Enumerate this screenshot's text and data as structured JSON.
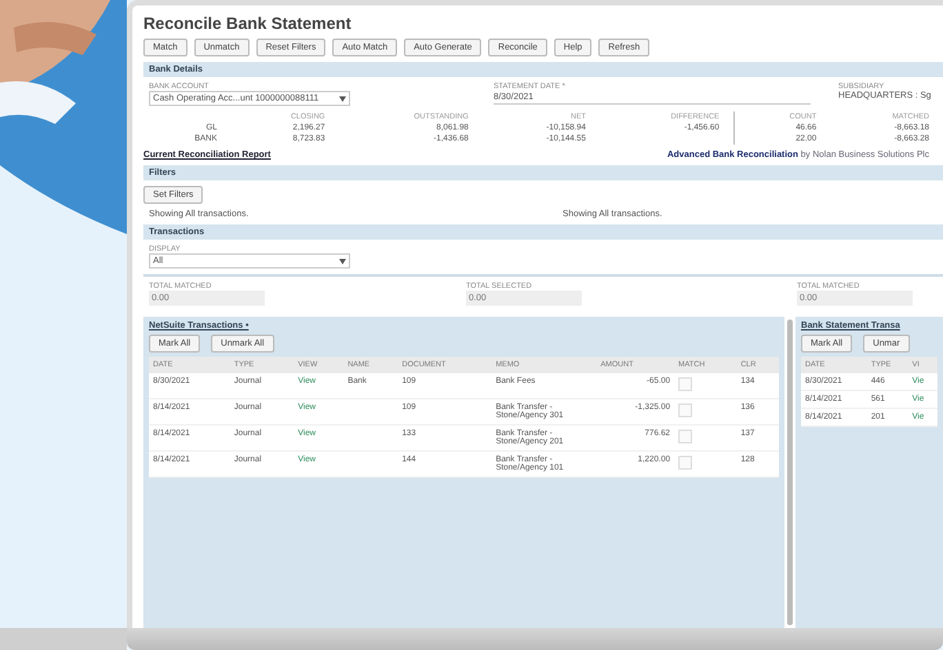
{
  "page": {
    "title": "Reconcile Bank Statement"
  },
  "toolbar": [
    "Match",
    "Unmatch",
    "Reset Filters",
    "Auto Match",
    "Auto Generate",
    "Reconcile",
    "Help",
    "Refresh"
  ],
  "bank_details": {
    "header": "Bank Details",
    "fields": [
      {
        "label": "BANK ACCOUNT",
        "value": "Cash Operating Acc...unt 1000000088111",
        "kind": "select"
      },
      {
        "label": "STATEMENT DATE *",
        "value": "8/30/2021",
        "kind": "input"
      },
      {
        "label": "SUBSIDIARY",
        "value": "HEADQUARTERS : Sg",
        "kind": "text"
      }
    ],
    "summary_columns": [
      "",
      "CLOSING",
      "OUTSTANDING",
      "NET",
      "DIFFERENCE",
      "COUNT",
      "MATCHED"
    ],
    "summary_rows": [
      [
        "GL",
        "2,196.27",
        "8,061.98",
        "-10,158.94",
        "-1,456.60",
        "46.66",
        "-8,663.18"
      ],
      [
        "BANK",
        "8,723.83",
        "-1,436.68",
        "-10,144.55",
        "",
        "22.00",
        "-8,663.28"
      ]
    ]
  },
  "report_link": "Current Reconciliation Report",
  "credit": "**Advanced Bank Reconciliation** by Nolan Business Solutions Plc",
  "filters": {
    "header": "Filters",
    "button": "Set Filters",
    "left_note": "Showing All transactions.",
    "right_note": "Showing All transactions."
  },
  "transactions": {
    "header": "Transactions",
    "display_label": "DISPLAY",
    "display_value": "All",
    "totals": [
      {
        "label": "TOTAL MATCHED",
        "value": "0.00"
      },
      {
        "label": "TOTAL SELECTED",
        "value": "0.00"
      }
    ],
    "right_total": {
      "label": "TOTAL MATCHED",
      "value": "0.00"
    }
  },
  "netsuite": {
    "title": "NetSuite Transactions •",
    "buttons": [
      "Mark All",
      "Unmark All"
    ],
    "columns": [
      "DATE",
      "TYPE",
      "VIEW",
      "NAME",
      "DOCUMENT",
      "MEMO",
      "AMOUNT",
      "MATCH",
      "CLR"
    ],
    "rows": [
      {
        "date": "8/30/2021",
        "type": "Journal",
        "view": "View",
        "name": "Bank",
        "document": "109",
        "memo": "Bank Fees",
        "amount": "-65.00",
        "match": false,
        "clr": "134"
      },
      {
        "date": "8/14/2021",
        "type": "Journal",
        "view": "View",
        "name": "",
        "document": "109",
        "memo": "Bank Transfer - Stone/Agency 301",
        "amount": "-1,325.00",
        "match": false,
        "clr": "136"
      },
      {
        "date": "8/14/2021",
        "type": "Journal",
        "view": "View",
        "name": "",
        "document": "133",
        "memo": "Bank Transfer - Stone/Agency 201",
        "amount": "776.62",
        "match": false,
        "clr": "137"
      },
      {
        "date": "8/14/2021",
        "type": "Journal",
        "view": "View",
        "name": "",
        "document": "144",
        "memo": "Bank Transfer - Stone/Agency 101",
        "amount": "1,220.00",
        "match": false,
        "clr": "128"
      }
    ]
  },
  "bank_statement": {
    "title": "Bank Statement Transa",
    "buttons": [
      "Mark All",
      "Unmar"
    ],
    "columns": [
      "DATE",
      "TYPE",
      "VI"
    ],
    "rows": [
      {
        "date": "8/30/2021",
        "type": "446",
        "view": "Vie"
      },
      {
        "date": "8/14/2021",
        "type": "561",
        "view": "Vie"
      },
      {
        "date": "8/14/2021",
        "type": "201",
        "view": "Vie"
      }
    ]
  }
}
